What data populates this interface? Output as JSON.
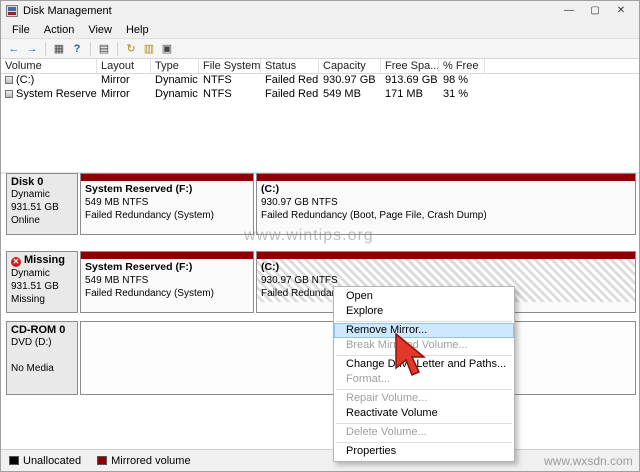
{
  "window": {
    "title": "Disk Management",
    "controls": {
      "minimize": "—",
      "maximize": "▢",
      "close": "✕"
    }
  },
  "menubar": [
    "File",
    "Action",
    "View",
    "Help"
  ],
  "toolbar_icons": [
    {
      "name": "back",
      "glyph": "←"
    },
    {
      "name": "forward",
      "glyph": "→"
    },
    {
      "name": "console-tree",
      "glyph": "▦"
    },
    {
      "name": "help",
      "glyph": "?"
    },
    {
      "name": "list-view",
      "glyph": "▤"
    },
    {
      "name": "refresh",
      "glyph": "↻"
    },
    {
      "name": "disk-properties",
      "glyph": "▥"
    },
    {
      "name": "graphical-view",
      "glyph": "▣"
    }
  ],
  "volume_table": {
    "columns": [
      "Volume",
      "Layout",
      "Type",
      "File System",
      "Status",
      "Capacity",
      "Free Spa...",
      "% Free"
    ],
    "rows": [
      [
        "(C:)",
        "Mirror",
        "Dynamic",
        "NTFS",
        "Failed Red...",
        "930.97 GB",
        "913.69 GB",
        "98 %"
      ],
      [
        "System Reserved (...",
        "Mirror",
        "Dynamic",
        "NTFS",
        "Failed Red...",
        "549 MB",
        "171 MB",
        "31 %"
      ]
    ]
  },
  "disks": [
    {
      "name": "Disk 0",
      "line1": "Dynamic",
      "line2": "931.51 GB",
      "line3": "Online",
      "partitions": [
        {
          "title": "System Reserved (F:)",
          "size": "549 MB NTFS",
          "status": "Failed Redundancy (System)"
        },
        {
          "title": "(C:)",
          "size": "930.97 GB NTFS",
          "status": "Failed Redundancy (Boot, Page File, Crash Dump)"
        }
      ]
    },
    {
      "name": "Missing",
      "line1": "Dynamic",
      "line2": "931.51 GB",
      "line3": "Missing",
      "missing_badge": "✕",
      "partitions": [
        {
          "title": "System Reserved (F:)",
          "size": "549 MB NTFS",
          "status": "Failed Redundancy (System)"
        },
        {
          "title": "(C:)",
          "size": "930.97 GB NTFS",
          "status": "Failed Redundancy"
        }
      ]
    },
    {
      "name": "CD-ROM 0",
      "line1": "DVD (D:)",
      "line2": "",
      "line3": "No Media"
    }
  ],
  "context_menu": {
    "items": [
      "Open",
      "Explore",
      "Remove Mirror...",
      "Break Mirrored Volume...",
      "Change Drive Letter and Paths...",
      "Format...",
      "Repair Volume...",
      "Reactivate Volume",
      "Delete Volume...",
      "Properties"
    ]
  },
  "legend": [
    {
      "label": "Unallocated",
      "color": "#000000"
    },
    {
      "label": "Mirrored volume",
      "color": "#8b0000"
    }
  ],
  "colors": {
    "mirrored_strip": "#8b0000",
    "menu_highlight": "#cde8ff"
  },
  "watermarks": {
    "center": "www.wintips.org",
    "corner": "www.wxsdn.com"
  }
}
